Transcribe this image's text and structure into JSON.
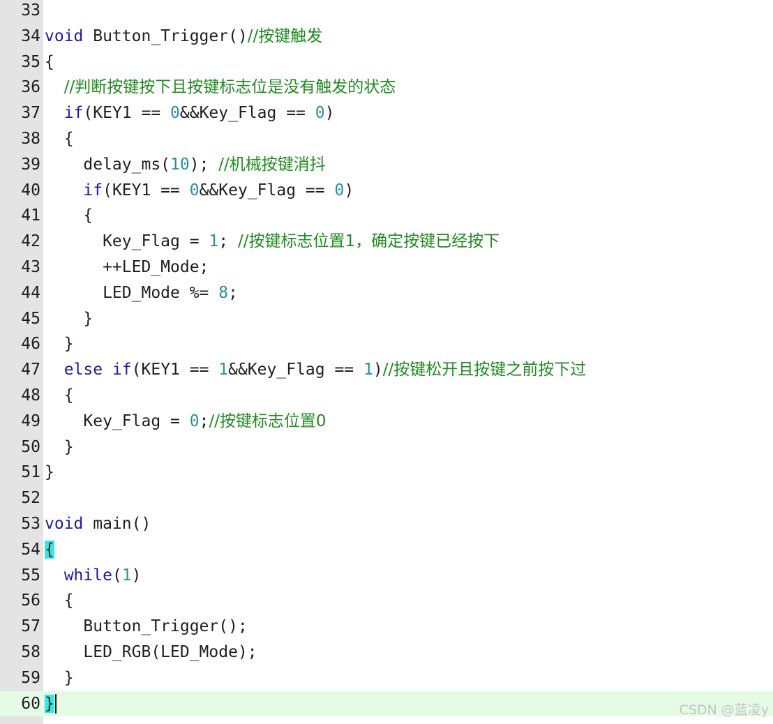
{
  "editor": {
    "lines": [
      {
        "no": "33",
        "tokens": []
      },
      {
        "no": "34",
        "tokens": [
          {
            "t": "kw",
            "v": "void"
          },
          {
            "t": "txt",
            "v": " Button_Trigger()"
          },
          {
            "t": "cmt",
            "v": "//按键触发"
          }
        ]
      },
      {
        "no": "35",
        "tokens": [
          {
            "t": "txt",
            "v": "{"
          }
        ]
      },
      {
        "no": "36",
        "tokens": [
          {
            "t": "txt",
            "v": "  "
          },
          {
            "t": "cmt",
            "v": "//判断按键按下且按键标志位是没有触发的状态"
          }
        ]
      },
      {
        "no": "37",
        "tokens": [
          {
            "t": "txt",
            "v": "  "
          },
          {
            "t": "kw",
            "v": "if"
          },
          {
            "t": "txt",
            "v": "(KEY1 == "
          },
          {
            "t": "num",
            "v": "0"
          },
          {
            "t": "txt",
            "v": "&&Key_Flag == "
          },
          {
            "t": "num",
            "v": "0"
          },
          {
            "t": "txt",
            "v": ")"
          }
        ]
      },
      {
        "no": "38",
        "tokens": [
          {
            "t": "txt",
            "v": "  {"
          }
        ]
      },
      {
        "no": "39",
        "tokens": [
          {
            "t": "txt",
            "v": "    delay_ms("
          },
          {
            "t": "num",
            "v": "10"
          },
          {
            "t": "txt",
            "v": "); "
          },
          {
            "t": "cmt",
            "v": "//机械按键消抖"
          }
        ]
      },
      {
        "no": "40",
        "tokens": [
          {
            "t": "txt",
            "v": "    "
          },
          {
            "t": "kw",
            "v": "if"
          },
          {
            "t": "txt",
            "v": "(KEY1 == "
          },
          {
            "t": "num",
            "v": "0"
          },
          {
            "t": "txt",
            "v": "&&Key_Flag == "
          },
          {
            "t": "num",
            "v": "0"
          },
          {
            "t": "txt",
            "v": ")"
          }
        ]
      },
      {
        "no": "41",
        "tokens": [
          {
            "t": "txt",
            "v": "    {"
          }
        ]
      },
      {
        "no": "42",
        "tokens": [
          {
            "t": "txt",
            "v": "      Key_Flag = "
          },
          {
            "t": "num",
            "v": "1"
          },
          {
            "t": "txt",
            "v": "; "
          },
          {
            "t": "cmt",
            "v": "//按键标志位置1，确定按键已经按下"
          }
        ]
      },
      {
        "no": "43",
        "tokens": [
          {
            "t": "txt",
            "v": "      ++LED_Mode;"
          }
        ]
      },
      {
        "no": "44",
        "tokens": [
          {
            "t": "txt",
            "v": "      LED_Mode %= "
          },
          {
            "t": "num",
            "v": "8"
          },
          {
            "t": "txt",
            "v": ";"
          }
        ]
      },
      {
        "no": "45",
        "tokens": [
          {
            "t": "txt",
            "v": "    }"
          }
        ]
      },
      {
        "no": "46",
        "tokens": [
          {
            "t": "txt",
            "v": "  }"
          }
        ]
      },
      {
        "no": "47",
        "tokens": [
          {
            "t": "txt",
            "v": "  "
          },
          {
            "t": "kw",
            "v": "else"
          },
          {
            "t": "txt",
            "v": " "
          },
          {
            "t": "kw",
            "v": "if"
          },
          {
            "t": "txt",
            "v": "(KEY1 == "
          },
          {
            "t": "num",
            "v": "1"
          },
          {
            "t": "txt",
            "v": "&&Key_Flag == "
          },
          {
            "t": "num",
            "v": "1"
          },
          {
            "t": "txt",
            "v": ")"
          },
          {
            "t": "cmt",
            "v": "//按键松开且按键之前按下过"
          }
        ]
      },
      {
        "no": "48",
        "tokens": [
          {
            "t": "txt",
            "v": "  {"
          }
        ]
      },
      {
        "no": "49",
        "tokens": [
          {
            "t": "txt",
            "v": "    Key_Flag = "
          },
          {
            "t": "num",
            "v": "0"
          },
          {
            "t": "txt",
            "v": ";"
          },
          {
            "t": "cmt",
            "v": "//按键标志位置0"
          }
        ]
      },
      {
        "no": "50",
        "tokens": [
          {
            "t": "txt",
            "v": "  }"
          }
        ]
      },
      {
        "no": "51",
        "tokens": [
          {
            "t": "txt",
            "v": "}"
          }
        ]
      },
      {
        "no": "52",
        "tokens": []
      },
      {
        "no": "53",
        "tokens": [
          {
            "t": "kw",
            "v": "void"
          },
          {
            "t": "txt",
            "v": " main()"
          }
        ]
      },
      {
        "no": "54",
        "tokens": [
          {
            "t": "hl",
            "v": "{"
          }
        ]
      },
      {
        "no": "55",
        "tokens": [
          {
            "t": "txt",
            "v": "  "
          },
          {
            "t": "kw",
            "v": "while"
          },
          {
            "t": "txt",
            "v": "("
          },
          {
            "t": "num",
            "v": "1"
          },
          {
            "t": "txt",
            "v": ")"
          }
        ]
      },
      {
        "no": "56",
        "tokens": [
          {
            "t": "txt",
            "v": "  {"
          }
        ]
      },
      {
        "no": "57",
        "tokens": [
          {
            "t": "txt",
            "v": "    Button_Trigger();"
          }
        ]
      },
      {
        "no": "58",
        "tokens": [
          {
            "t": "txt",
            "v": "    LED_RGB(LED_Mode);"
          }
        ]
      },
      {
        "no": "59",
        "tokens": [
          {
            "t": "txt",
            "v": "  }"
          }
        ]
      },
      {
        "no": "60",
        "current": true,
        "caret": true,
        "tokens": [
          {
            "t": "hl",
            "v": "}"
          }
        ]
      }
    ]
  },
  "colors": {
    "keyword": "#1a1aa6",
    "number": "#2a8fa3",
    "comment": "#1f8a1f",
    "brace_match": "#39e6e6",
    "current_line": "#e6fbe6",
    "gutter": "#e4e4e4"
  },
  "watermark": "CSDN @蓝凌y"
}
